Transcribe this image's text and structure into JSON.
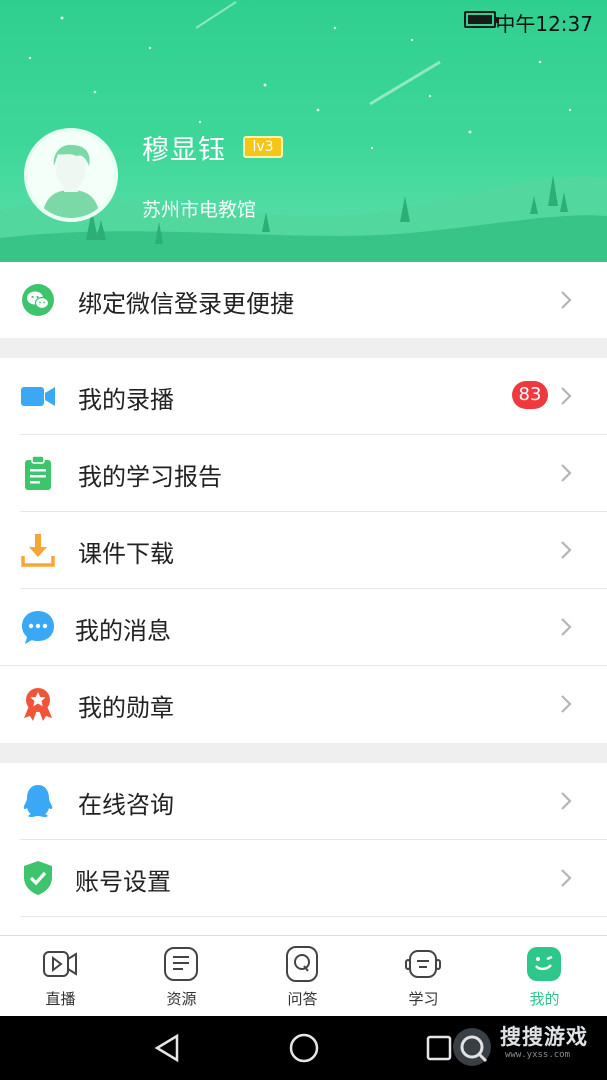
{
  "status_bar": {
    "time": "中午12:37",
    "battery_icon": "battery-full-icon"
  },
  "profile": {
    "name": "穆显钰",
    "level": "lv3",
    "organization": "苏州市电教馆",
    "avatar_icon": "default-avatar-icon"
  },
  "bind_row": {
    "label": "绑定微信登录更便捷",
    "icon": "wechat-icon"
  },
  "menu_group_1": [
    {
      "label": "我的录播",
      "icon": "video-camera-icon",
      "badge": "83"
    },
    {
      "label": "我的学习报告",
      "icon": "clipboard-report-icon"
    },
    {
      "label": "课件下载",
      "icon": "download-icon"
    },
    {
      "label": "我的消息",
      "icon": "chat-bubble-icon"
    },
    {
      "label": "我的勋章",
      "icon": "medal-icon"
    }
  ],
  "menu_group_2": [
    {
      "label": "在线咨询",
      "icon": "qq-penguin-icon"
    },
    {
      "label": "账号设置",
      "icon": "shield-check-icon"
    }
  ],
  "tabs": [
    {
      "label": "直播",
      "icon": "live-video-icon",
      "active": false
    },
    {
      "label": "资源",
      "icon": "resource-document-icon",
      "active": false
    },
    {
      "label": "问答",
      "icon": "qa-icon",
      "active": false
    },
    {
      "label": "学习",
      "icon": "study-robot-icon",
      "active": false
    },
    {
      "label": "我的",
      "icon": "smiley-face-icon",
      "active": true
    }
  ],
  "watermark": {
    "text": "搜搜游戏",
    "sub": "www.yxss.com"
  },
  "colors": {
    "accent": "#2dc889",
    "header_top": "#2fcf8f",
    "badge_red": "#f0393f",
    "level_gold": "#f5c518"
  }
}
